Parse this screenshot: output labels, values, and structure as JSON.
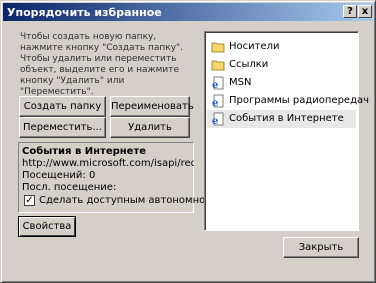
{
  "window": {
    "title": "Упорядочить избранное",
    "help_label": "?",
    "close_label": "x"
  },
  "intro_text": "Чтобы создать новую папку, нажмите кнопку \"Создать папку\". Чтобы удалить или переместить объект, выделите его и нажмите кнопку \"Удалить\" или \"Переместить\".",
  "buttons": {
    "create_folder": "Создать папку",
    "rename": "Переименовать",
    "move": "Переместить...",
    "delete": "Удалить",
    "properties": "Свойства",
    "close": "Закрыть"
  },
  "info": {
    "title": "События в Интернете",
    "url": "http://www.microsoft.com/isapi/redir.dll...",
    "visits": "Посещений: 0",
    "last_visit": "Посл. посещение:",
    "offline_label": "Сделать доступным автономно",
    "offline_checked": "✓"
  },
  "favorites": [
    {
      "label": "Носители",
      "icon": "folder-icon"
    },
    {
      "label": "Ссылки",
      "icon": "folder-icon"
    },
    {
      "label": "MSN",
      "icon": "ie-page-icon"
    },
    {
      "label": "Программы радиопередач",
      "icon": "ie-page-icon"
    },
    {
      "label": "События в Интернете",
      "icon": "ie-page-icon",
      "selected": true
    }
  ]
}
